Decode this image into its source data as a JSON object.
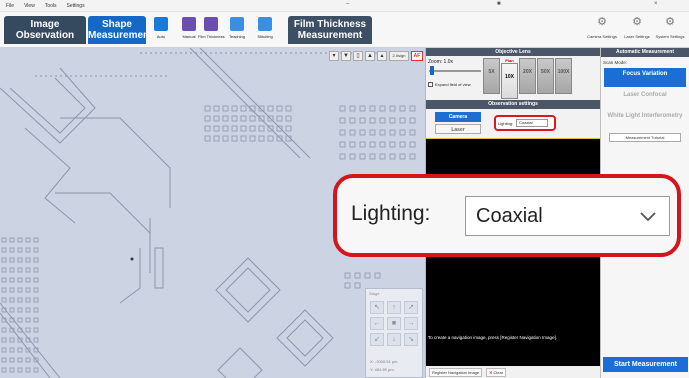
{
  "menu": [
    "File",
    "View",
    "Tools",
    "Settings"
  ],
  "tabs": {
    "image_observation": "Image Observation",
    "shape_measurement": "Shape Measurement",
    "film_thickness": "Film Thickness Measurement"
  },
  "toolbar": [
    {
      "label": "Auto",
      "icon": "auto-icon",
      "color": "#1a7ad9"
    },
    {
      "label": "Manual",
      "icon": "manual-icon",
      "color": "#6a4fb0"
    },
    {
      "label": "Film Thickness",
      "icon": "film-icon",
      "color": "#6a4fb0"
    },
    {
      "label": "Teaching",
      "icon": "teaching-icon",
      "color": "#3a8fe0"
    },
    {
      "label": "Stitching",
      "icon": "stitching-icon",
      "color": "#3a8fe0"
    }
  ],
  "right_toolbar": [
    {
      "label": "Camera Settings",
      "icon": "camera-settings-icon"
    },
    {
      "label": "Laser Settings",
      "icon": "laser-settings-icon"
    },
    {
      "label": "System Settings",
      "icon": "system-settings-icon"
    }
  ],
  "viewer": {
    "zoom_button": "2.0sign",
    "af_button": "AF",
    "stage_title": "Stage",
    "coord_x": "X:   -3000.51  μm",
    "coord_y": "Y:     484.69  μm"
  },
  "objective_lens": {
    "title": "Objective Lens",
    "zoom_label": "Zoom: 1.0x",
    "expand_label": "Expand field of view",
    "lenses": [
      {
        "name": "5X",
        "active": false
      },
      {
        "name": "10X",
        "active": true,
        "tag": "Plan"
      },
      {
        "name": "20X",
        "active": false
      },
      {
        "name": "50X",
        "active": false
      },
      {
        "name": "100X",
        "active": false
      }
    ]
  },
  "observation": {
    "title": "Observation settings",
    "camera_label": "Camera",
    "laser_label": "Laser",
    "lighting_label": "Lighting:",
    "lighting_value": "Coaxial",
    "nav_text": "To create a navigation image, press [Register Navigation Image].",
    "register_button": "Register Navigation Image",
    "clear_button": "Clear"
  },
  "auto_measurement": {
    "title": "Automatic Measurement",
    "scan_mode_label": "Scan Mode:",
    "modes": [
      "Focus Variation",
      "Laser Confocal",
      "White Light Interferometry"
    ],
    "tutorial": "Measurement Tutorial",
    "start_button": "Start Measurement"
  },
  "callout": {
    "label": "Lighting:",
    "value": "Coaxial"
  },
  "colors": {
    "accent": "#1a6ed6",
    "highlight": "#d7141c",
    "tab_dark": "#35495f"
  }
}
